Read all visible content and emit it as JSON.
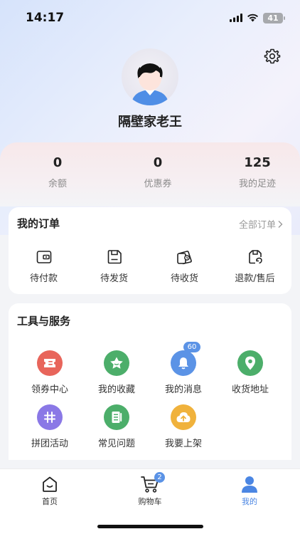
{
  "status_bar": {
    "time": "14:17",
    "battery": "41",
    "icons": [
      "signal-icon",
      "wifi-icon",
      "battery-icon"
    ]
  },
  "profile": {
    "username": "隔壁家老王",
    "avatar_icon": "avatar-cartoon-icon",
    "settings_icon": "gear-icon"
  },
  "stats": [
    {
      "value": "0",
      "label": "余额"
    },
    {
      "value": "0",
      "label": "优惠券"
    },
    {
      "value": "125",
      "label": "我的足迹"
    }
  ],
  "orders": {
    "title": "我的订单",
    "more_label": "全部订单",
    "items": [
      {
        "label": "待付款",
        "icon": "wallet-icon"
      },
      {
        "label": "待发货",
        "icon": "box-icon"
      },
      {
        "label": "待收货",
        "icon": "delivery-icon"
      },
      {
        "label": "退款/售后",
        "icon": "refund-icon"
      }
    ]
  },
  "tools": {
    "title": "工具与服务",
    "items": [
      {
        "label": "领券中心",
        "icon": "coupon-icon",
        "color": "#e8655b"
      },
      {
        "label": "我的收藏",
        "icon": "favorite-icon",
        "color": "#4cae6a"
      },
      {
        "label": "我的消息",
        "icon": "bell-icon",
        "color": "#5b93e6",
        "badge": "60"
      },
      {
        "label": "收货地址",
        "icon": "location-icon",
        "color": "#4cae6a"
      },
      {
        "label": "拼团活动",
        "icon": "group-buy-icon",
        "color": "#8a78e6"
      },
      {
        "label": "常见问题",
        "icon": "faq-icon",
        "color": "#4cae6a"
      },
      {
        "label": "我要上架",
        "icon": "upload-icon",
        "color": "#f0b23c"
      }
    ]
  },
  "tabbar": {
    "items": [
      {
        "label": "首页",
        "icon": "home-icon"
      },
      {
        "label": "购物车",
        "icon": "cart-icon",
        "badge": "2"
      },
      {
        "label": "我的",
        "icon": "user-icon",
        "active": true
      }
    ],
    "accent_color": "#4b86e3"
  }
}
